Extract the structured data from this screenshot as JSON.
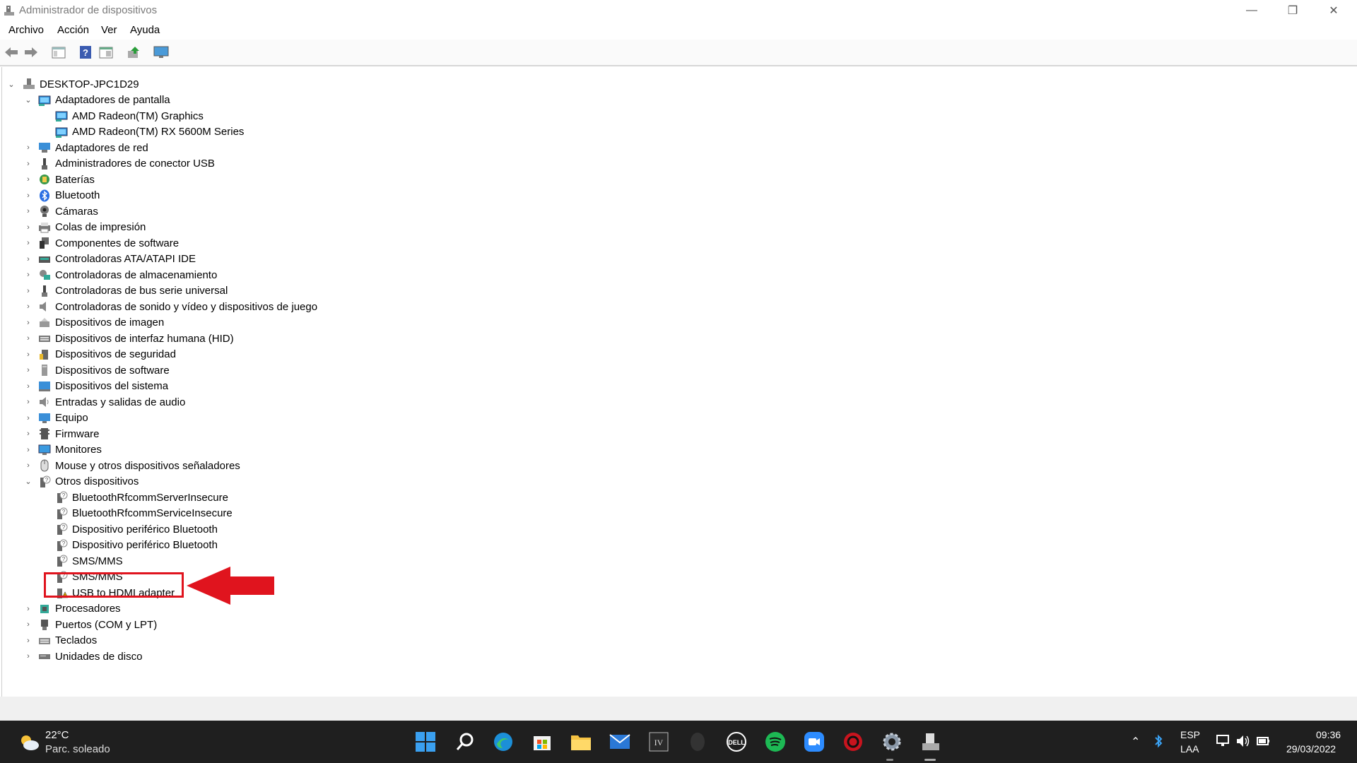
{
  "window": {
    "title": "Administrador de dispositivos",
    "controls": [
      "minimize",
      "restore",
      "close"
    ]
  },
  "menu": {
    "items": [
      "Archivo",
      "Acción",
      "Ver",
      "Ayuda"
    ]
  },
  "toolbar": {
    "buttons": [
      "back-icon",
      "forward-icon",
      "show-hide-tree-icon",
      "help-icon",
      "properties-icon",
      "update-driver-icon",
      "monitor-icon"
    ]
  },
  "tree": {
    "root": "DESKTOP-JPC1D29",
    "nodes": [
      {
        "label": "Adaptadores de pantalla",
        "icon": "display-adapter-icon",
        "expanded": true
      },
      {
        "label": "AMD Radeon(TM) Graphics",
        "icon": "display-adapter-icon",
        "child": true
      },
      {
        "label": "AMD Radeon(TM) RX 5600M Series",
        "icon": "display-adapter-icon",
        "child": true
      },
      {
        "label": "Adaptadores de red",
        "icon": "network-adapter-icon"
      },
      {
        "label": "Administradores de conector USB",
        "icon": "usb-connector-icon"
      },
      {
        "label": "Baterías",
        "icon": "battery-icon"
      },
      {
        "label": "Bluetooth",
        "icon": "bluetooth-icon"
      },
      {
        "label": "Cámaras",
        "icon": "camera-icon"
      },
      {
        "label": "Colas de impresión",
        "icon": "printer-icon"
      },
      {
        "label": "Componentes de software",
        "icon": "software-component-icon"
      },
      {
        "label": "Controladoras ATA/ATAPI IDE",
        "icon": "ide-controller-icon"
      },
      {
        "label": "Controladoras de almacenamiento",
        "icon": "storage-controller-icon"
      },
      {
        "label": "Controladoras de bus serie universal",
        "icon": "usb-controller-icon"
      },
      {
        "label": "Controladoras de sonido y vídeo y dispositivos de juego",
        "icon": "sound-icon"
      },
      {
        "label": "Dispositivos de imagen",
        "icon": "imaging-device-icon"
      },
      {
        "label": "Dispositivos de interfaz humana (HID)",
        "icon": "hid-icon"
      },
      {
        "label": "Dispositivos de seguridad",
        "icon": "security-device-icon"
      },
      {
        "label": "Dispositivos de software",
        "icon": "software-device-icon"
      },
      {
        "label": "Dispositivos del sistema",
        "icon": "system-device-icon"
      },
      {
        "label": "Entradas y salidas de audio",
        "icon": "audio-io-icon"
      },
      {
        "label": "Equipo",
        "icon": "computer-icon"
      },
      {
        "label": "Firmware",
        "icon": "firmware-icon"
      },
      {
        "label": "Monitores",
        "icon": "monitor-icon"
      },
      {
        "label": "Mouse y otros dispositivos señaladores",
        "icon": "mouse-icon"
      },
      {
        "label": "Otros dispositivos",
        "icon": "unknown-device-icon",
        "expanded": true
      },
      {
        "label": "BluetoothRfcommServerInsecure",
        "icon": "unknown-device-icon",
        "child": true
      },
      {
        "label": "BluetoothRfcommServiceInsecure",
        "icon": "unknown-device-icon",
        "child": true
      },
      {
        "label": "Dispositivo periférico Bluetooth",
        "icon": "unknown-device-icon",
        "child": true
      },
      {
        "label": "Dispositivo periférico Bluetooth",
        "icon": "unknown-device-icon",
        "child": true
      },
      {
        "label": "SMS/MMS",
        "icon": "unknown-device-icon",
        "child": true
      },
      {
        "label": "SMS/MMS",
        "icon": "unknown-device-icon",
        "child": true
      },
      {
        "label": "USB to HDMI adapter",
        "icon": "warning-device-icon",
        "child": true
      },
      {
        "label": "Procesadores",
        "icon": "processor-icon"
      },
      {
        "label": "Puertos (COM y LPT)",
        "icon": "port-icon"
      },
      {
        "label": "Teclados",
        "icon": "keyboard-icon"
      },
      {
        "label": "Unidades de disco",
        "icon": "disk-drive-icon"
      }
    ]
  },
  "taskbar": {
    "weather_temp": "22°C",
    "weather_desc": "Parc. soleado",
    "apps": [
      "start-icon",
      "search-icon",
      "edge-icon",
      "store-icon",
      "file-explorer-icon",
      "mail-icon",
      "iv-app-icon",
      "alienware-icon",
      "dell-icon",
      "spotify-icon",
      "zoom-icon",
      "red-app-icon",
      "settings-icon",
      "device-manager-icon"
    ],
    "lang_top": "ESP",
    "lang_bottom": "LAA",
    "time": "09:36",
    "date": "29/03/2022"
  },
  "colors": {
    "highlight": "#e0141e",
    "taskbar": "#1f1f1f"
  }
}
